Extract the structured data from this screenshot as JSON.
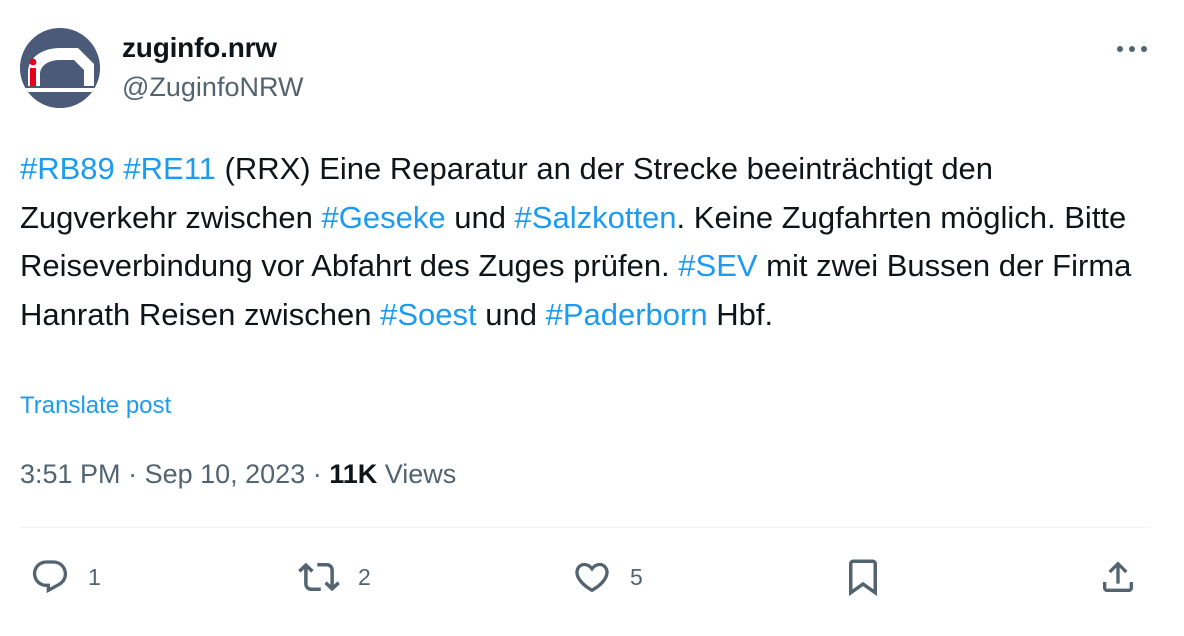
{
  "author": {
    "name": "zuginfo.nrw",
    "handle": "@ZuginfoNRW"
  },
  "tweet": {
    "segments": [
      {
        "text": "#RB89",
        "hashtag": true
      },
      {
        "text": " ",
        "hashtag": false
      },
      {
        "text": "#RE11",
        "hashtag": true
      },
      {
        "text": " (RRX) Eine Reparatur an der Strecke beeinträchtigt den Zugverkehr zwischen ",
        "hashtag": false
      },
      {
        "text": "#Geseke",
        "hashtag": true
      },
      {
        "text": " und ",
        "hashtag": false
      },
      {
        "text": "#Salzkotten",
        "hashtag": true
      },
      {
        "text": ". Keine Zugfahrten möglich. Bitte Reiseverbindung vor Abfahrt des Zuges prüfen. ",
        "hashtag": false
      },
      {
        "text": "#SEV",
        "hashtag": true
      },
      {
        "text": " mit zwei Bussen der Firma Hanrath Reisen zwischen ",
        "hashtag": false
      },
      {
        "text": "#Soest",
        "hashtag": true
      },
      {
        "text": " und ",
        "hashtag": false
      },
      {
        "text": "#Paderborn",
        "hashtag": true
      },
      {
        "text": " Hbf.",
        "hashtag": false
      }
    ],
    "translate_label": "Translate post",
    "time": "3:51 PM",
    "separator": " · ",
    "date": "Sep 10, 2023",
    "views_count": "11K",
    "views_label": " Views"
  },
  "actions": {
    "replies": "1",
    "retweets": "2",
    "likes": "5"
  },
  "icons": {
    "more": "more-icon",
    "reply": "reply-icon",
    "retweet": "retweet-icon",
    "like": "like-icon",
    "bookmark": "bookmark-icon",
    "share": "share-icon"
  },
  "colors": {
    "link": "#1d9bf0",
    "text": "#0f1419",
    "secondary": "#536471",
    "divider": "#eff3f4",
    "avatar_bg": "#4a5a78"
  }
}
